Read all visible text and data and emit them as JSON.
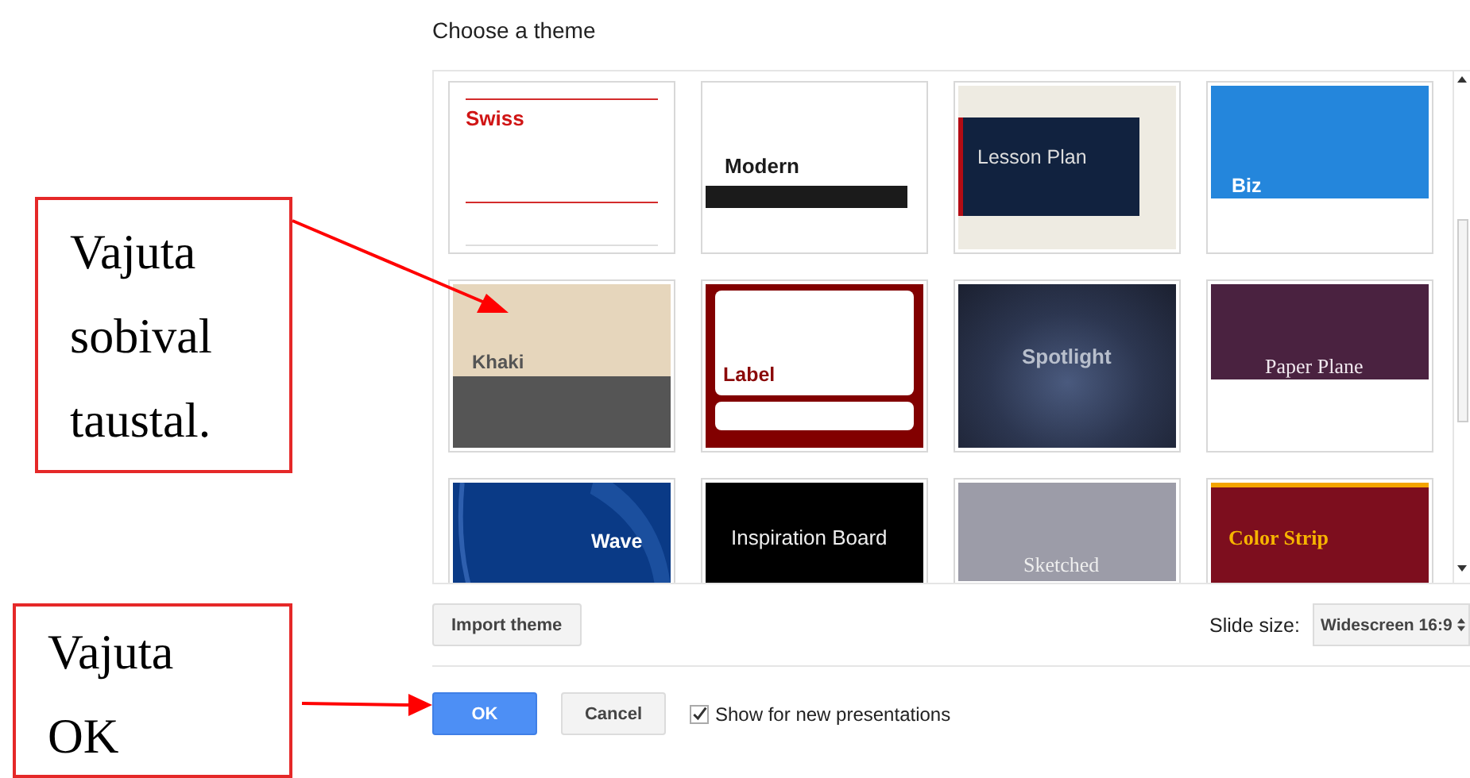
{
  "dialog": {
    "title": "Choose a theme",
    "themes": [
      {
        "name": "Swiss",
        "kind": "swiss"
      },
      {
        "name": "Modern",
        "kind": "modern"
      },
      {
        "name": "Lesson Plan",
        "kind": "lesson"
      },
      {
        "name": "Biz",
        "kind": "biz"
      },
      {
        "name": "Khaki",
        "kind": "khaki"
      },
      {
        "name": "Label",
        "kind": "label"
      },
      {
        "name": "Spotlight",
        "kind": "spotlight"
      },
      {
        "name": "Paper Plane",
        "kind": "paperplane"
      },
      {
        "name": "Wave",
        "kind": "wave"
      },
      {
        "name": "Inspiration Board",
        "kind": "inspiration"
      },
      {
        "name": "Sketched",
        "kind": "sketched"
      },
      {
        "name": "Color Strip",
        "kind": "colorstrip"
      }
    ],
    "import_button": "Import theme",
    "slide_size": {
      "label": "Slide size:",
      "value": "Widescreen 16:9"
    },
    "ok_button": "OK",
    "cancel_button": "Cancel",
    "show_checkbox": {
      "label": "Show for new presentations",
      "checked": true
    }
  },
  "callouts": [
    {
      "text": "Vajuta sobival taustal."
    },
    {
      "text": "Vajuta OK"
    }
  ]
}
